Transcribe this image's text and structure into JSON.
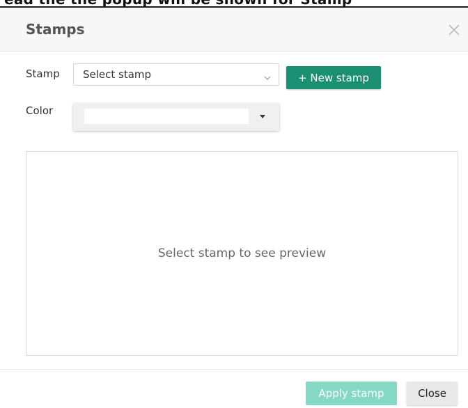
{
  "background": {
    "partial_heading": "ead the the popup will be shown for Stamp"
  },
  "dialog": {
    "title": "Stamps",
    "close_icon": "close-x-icon"
  },
  "form": {
    "stamp_label": "Stamp",
    "stamp_select_value": "Select stamp",
    "new_stamp_label": "+ New stamp",
    "color_label": "Color",
    "color_value": "#ffffff"
  },
  "preview": {
    "placeholder": "Select stamp to see preview"
  },
  "footer": {
    "apply_label": "Apply stamp",
    "close_label": "Close"
  },
  "colors": {
    "primary": "#1b8f72",
    "primary_disabled": "#84d8c4",
    "header_bg": "#f7f7f7"
  }
}
